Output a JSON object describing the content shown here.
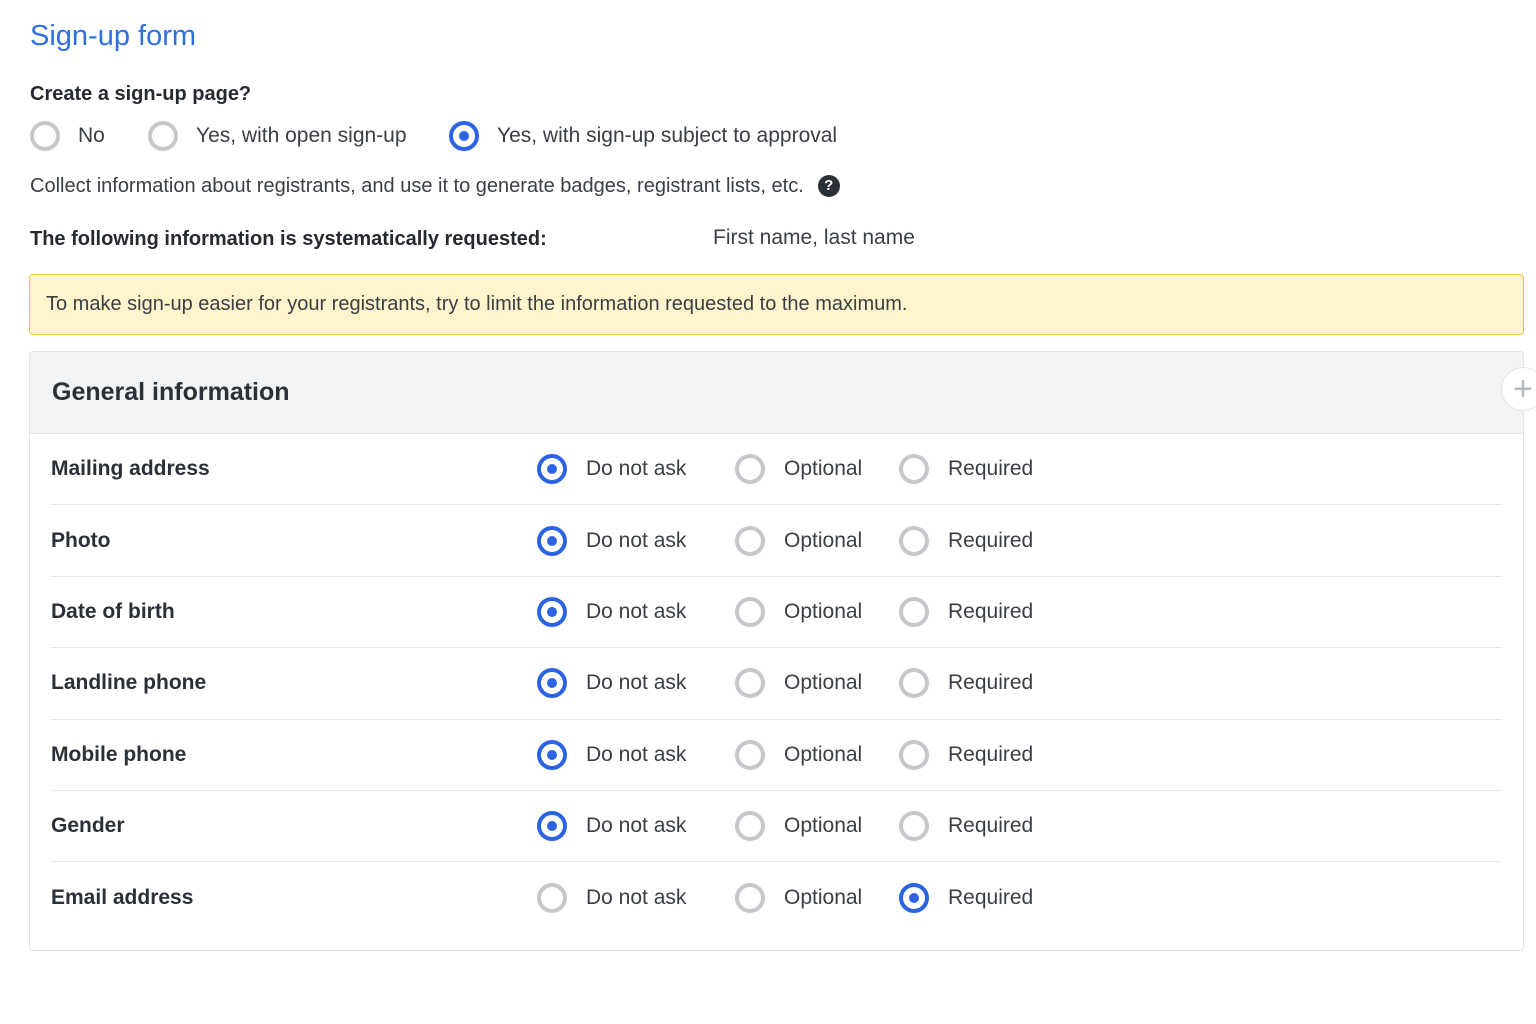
{
  "title": "Sign-up form",
  "question": "Create a sign-up page?",
  "signup_options": [
    {
      "label": "No",
      "selected": false
    },
    {
      "label": "Yes, with open sign-up",
      "selected": false
    },
    {
      "label": "Yes, with sign-up subject to approval",
      "selected": true
    }
  ],
  "description": "Collect information about registrants, and use it to generate badges, registrant lists, etc.",
  "help_icon": "question-circle-icon",
  "systematic": {
    "label": "The following information is systematically requested:",
    "value": "First name, last name"
  },
  "notice": "To make sign-up easier for your registrants, try to limit the information requested to the maximum.",
  "panel": {
    "title": "General information",
    "add_icon": "plus-icon",
    "choice_labels": [
      "Do not ask",
      "Optional",
      "Required"
    ],
    "rows": [
      {
        "label": "Mailing address",
        "selected": 0
      },
      {
        "label": "Photo",
        "selected": 0
      },
      {
        "label": "Date of birth",
        "selected": 0
      },
      {
        "label": "Landline phone",
        "selected": 0
      },
      {
        "label": "Mobile phone",
        "selected": 0
      },
      {
        "label": "Gender",
        "selected": 0
      },
      {
        "label": "Email address",
        "selected": 2
      }
    ]
  },
  "colors": {
    "accent": "#2c63e3",
    "title": "#2f6fe0",
    "notice_bg": "#fff4cc",
    "notice_border": "#e9c64a"
  }
}
